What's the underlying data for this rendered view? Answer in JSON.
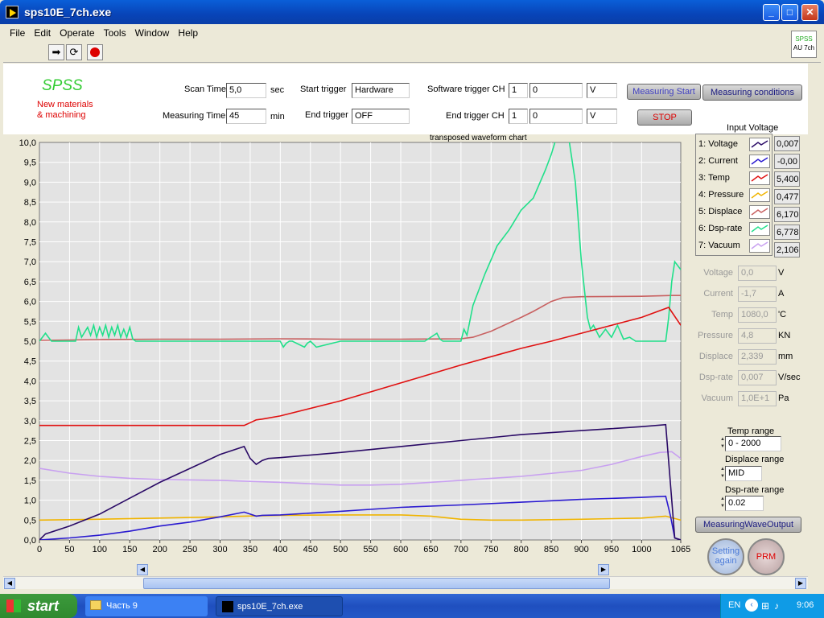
{
  "window": {
    "title": "sps10E_7ch.exe",
    "minimize": "_",
    "maximize": "□",
    "close": "✕"
  },
  "menu": [
    "File",
    "Edit",
    "Operate",
    "Tools",
    "Window",
    "Help"
  ],
  "badge": {
    "line1": "SPSS",
    "line2": "AU 7ch"
  },
  "logo": {
    "title": "SPSS",
    "line1": "New materials",
    "line2": "& machining"
  },
  "params": {
    "scan_time_label": "Scan Time",
    "scan_time": "5,0",
    "scan_time_unit": "sec",
    "measuring_time_label": "Measuring Time",
    "measuring_time": "45",
    "measuring_time_unit": "min",
    "start_trigger_label": "Start trigger",
    "start_trigger": "Hardware",
    "end_trigger_label": "End trigger",
    "end_trigger": "OFF",
    "sw_trigger_label": "Software trigger CH",
    "sw_trigger_ch": "1",
    "sw_trigger_val": "0",
    "sw_trigger_unit": "V",
    "end_trigger_ch_label": "End trigger CH",
    "end_trigger_ch": "1",
    "end_trigger_val": "0",
    "end_trigger_unit": "V"
  },
  "buttons": {
    "measuring_start": "Measuring Start",
    "measuring_conditions": "Measuring conditions",
    "stop": "STOP",
    "wave_output": "MeasuringWaveOutput",
    "setting_again": "Setting again",
    "prm": "PRM"
  },
  "input_voltage_label": "Input Voltage",
  "channels": [
    {
      "name": "1: Voltage",
      "color": "#2a0a66",
      "value": "0,007"
    },
    {
      "name": "2: Current",
      "color": "#2a1ad0",
      "value": "-0,00"
    },
    {
      "name": "3: Temp",
      "color": "#e01010",
      "value": "5,400"
    },
    {
      "name": "4: Pressure",
      "color": "#f0b400",
      "value": "0,477"
    },
    {
      "name": "5: Displace",
      "color": "#c86060",
      "value": "6,170"
    },
    {
      "name": "6: Dsp-rate",
      "color": "#20e08a",
      "value": "6,778"
    },
    {
      "name": "7: Vacuum",
      "color": "#c8a0f0",
      "value": "2,106"
    }
  ],
  "readouts": [
    {
      "label": "Voltage",
      "value": "0,0",
      "unit": "V"
    },
    {
      "label": "Current",
      "value": "-1,7",
      "unit": "A"
    },
    {
      "label": "Temp",
      "value": "1080,0",
      "unit": "'C"
    },
    {
      "label": "Pressure",
      "value": "4,8",
      "unit": "KN"
    },
    {
      "label": "Displace",
      "value": "2,339",
      "unit": "mm"
    },
    {
      "label": "Dsp-rate",
      "value": "0,007",
      "unit": "V/sec"
    },
    {
      "label": "Vacuum",
      "value": "1,0E+1",
      "unit": "Pa"
    }
  ],
  "ranges": {
    "temp_label": "Temp range",
    "temp": "0 - 2000",
    "displace_label": "Displace range",
    "displace": "MID",
    "dsprate_label": "Dsp-rate range",
    "dsprate": "0.02"
  },
  "chart_data": {
    "type": "line",
    "title": "transposed waveform chart",
    "xlim": [
      0,
      1065
    ],
    "ylim": [
      0,
      10
    ],
    "x_ticks": [
      0,
      50,
      100,
      150,
      200,
      250,
      300,
      350,
      400,
      450,
      500,
      550,
      600,
      650,
      700,
      750,
      800,
      850,
      900,
      950,
      1000,
      1065
    ],
    "y_ticks": [
      "0,0",
      "0,5",
      "1,0",
      "1,5",
      "2,0",
      "2,5",
      "3,0",
      "3,5",
      "4,0",
      "4,5",
      "5,0",
      "5,5",
      "6,0",
      "6,5",
      "7,0",
      "7,5",
      "8,0",
      "8,5",
      "9,0",
      "9,5",
      "10,0"
    ],
    "grid": true,
    "series": [
      {
        "name": "1: Voltage",
        "x": [
          0,
          10,
          50,
          100,
          150,
          200,
          250,
          300,
          340,
          350,
          360,
          370,
          380,
          400,
          500,
          600,
          700,
          800,
          900,
          950,
          1000,
          1040,
          1050,
          1055,
          1065
        ],
        "y": [
          0,
          0.15,
          0.35,
          0.65,
          1.05,
          1.45,
          1.8,
          2.15,
          2.35,
          2.05,
          1.9,
          2.0,
          2.05,
          2.07,
          2.2,
          2.35,
          2.5,
          2.65,
          2.75,
          2.8,
          2.85,
          2.9,
          1.0,
          0.05,
          0.0
        ]
      },
      {
        "name": "2: Current",
        "x": [
          0,
          50,
          100,
          150,
          200,
          250,
          300,
          340,
          350,
          360,
          370,
          400,
          500,
          600,
          700,
          800,
          900,
          1000,
          1040,
          1048,
          1055,
          1065
        ],
        "y": [
          0,
          0.05,
          0.12,
          0.22,
          0.35,
          0.45,
          0.58,
          0.7,
          0.65,
          0.6,
          0.62,
          0.63,
          0.72,
          0.82,
          0.88,
          0.95,
          1.02,
          1.07,
          1.1,
          0.6,
          0.05,
          0.0
        ]
      },
      {
        "name": "3: Temp",
        "x": [
          0,
          100,
          200,
          300,
          340,
          350,
          360,
          370,
          400,
          500,
          600,
          700,
          800,
          850,
          900,
          1000,
          1045,
          1065
        ],
        "y": [
          2.88,
          2.88,
          2.88,
          2.88,
          2.88,
          2.95,
          3.02,
          3.04,
          3.12,
          3.5,
          3.95,
          4.4,
          4.82,
          5.0,
          5.2,
          5.6,
          5.85,
          5.4
        ]
      },
      {
        "name": "4: Pressure",
        "x": [
          0,
          100,
          200,
          300,
          340,
          400,
          500,
          600,
          650,
          700,
          750,
          800,
          900,
          1000,
          1040,
          1065
        ],
        "y": [
          0.5,
          0.52,
          0.55,
          0.58,
          0.6,
          0.62,
          0.63,
          0.63,
          0.6,
          0.52,
          0.5,
          0.5,
          0.52,
          0.55,
          0.6,
          0.5
        ]
      },
      {
        "name": "5: Displace",
        "x": [
          0,
          50,
          100,
          200,
          300,
          400,
          500,
          600,
          700,
          720,
          750,
          800,
          820,
          850,
          860,
          870,
          900,
          1000,
          1050,
          1065
        ],
        "y": [
          5.02,
          5.03,
          5.04,
          5.05,
          5.05,
          5.06,
          5.05,
          5.05,
          5.06,
          5.1,
          5.25,
          5.6,
          5.75,
          6.0,
          6.05,
          6.1,
          6.12,
          6.13,
          6.15,
          6.15
        ]
      },
      {
        "name": "6: Dsp-rate",
        "x": [
          0,
          5,
          10,
          15,
          20,
          60,
          65,
          70,
          80,
          85,
          90,
          95,
          100,
          105,
          110,
          115,
          120,
          125,
          130,
          135,
          140,
          145,
          150,
          155,
          160,
          400,
          405,
          410,
          415,
          420,
          440,
          445,
          450,
          460,
          500,
          510,
          520,
          640,
          660,
          665,
          670,
          700,
          705,
          710,
          720,
          740,
          760,
          780,
          800,
          820,
          840,
          850,
          860,
          870,
          880,
          890,
          900,
          910,
          915,
          920,
          930,
          940,
          950,
          960,
          970,
          980,
          990,
          1000,
          1040,
          1045,
          1050,
          1055,
          1065
        ],
        "y": [
          5.0,
          5.1,
          5.2,
          5.1,
          5.0,
          5.0,
          5.35,
          5.1,
          5.35,
          5.15,
          5.4,
          5.1,
          5.35,
          5.15,
          5.4,
          5.1,
          5.35,
          5.15,
          5.4,
          5.1,
          5.3,
          5.1,
          5.35,
          5.05,
          5.0,
          5.0,
          4.85,
          4.95,
          5.0,
          5.0,
          4.85,
          4.95,
          5.0,
          4.85,
          5.0,
          5.0,
          5.0,
          5.0,
          5.2,
          5.05,
          5.0,
          5.0,
          5.3,
          5.15,
          5.9,
          6.7,
          7.4,
          7.8,
          8.3,
          8.6,
          9.3,
          9.7,
          10.2,
          10.2,
          10.0,
          9.0,
          7.0,
          5.6,
          5.3,
          5.4,
          5.1,
          5.3,
          5.1,
          5.4,
          5.05,
          5.1,
          5.0,
          5.0,
          5.0,
          5.6,
          6.5,
          7.0,
          6.8
        ]
      },
      {
        "name": "7: Vacuum",
        "x": [
          0,
          50,
          100,
          150,
          200,
          300,
          400,
          500,
          550,
          600,
          700,
          800,
          900,
          950,
          1000,
          1030,
          1050,
          1065
        ],
        "y": [
          1.8,
          1.68,
          1.6,
          1.55,
          1.52,
          1.5,
          1.45,
          1.38,
          1.38,
          1.4,
          1.5,
          1.6,
          1.75,
          1.9,
          2.1,
          2.2,
          2.22,
          2.05
        ]
      }
    ]
  },
  "taskbar": {
    "start": "start",
    "items": [
      "Часть 9",
      "sps10E_7ch.exe"
    ],
    "lang": "EN",
    "time": "9:06"
  }
}
